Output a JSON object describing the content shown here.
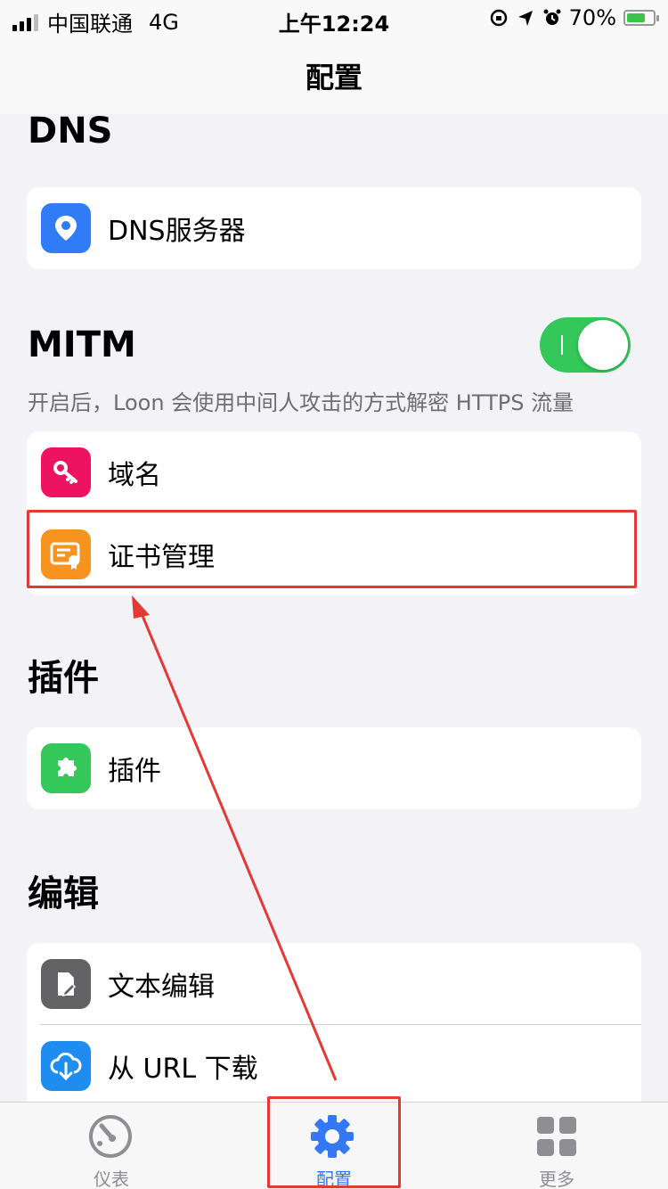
{
  "status_bar": {
    "carrier": "中国联通",
    "network": "4G",
    "time": "上午12:24",
    "battery": "70%",
    "battery_level": 0.7
  },
  "nav": {
    "title": "配置"
  },
  "sections": {
    "dns": {
      "title": "DNS",
      "items": [
        {
          "label": "DNS服务器",
          "icon": "location-pin-icon",
          "color": "#2f7cf6"
        }
      ]
    },
    "mitm": {
      "title": "MITM",
      "toggle_on": true,
      "note": "开启后，Loon 会使用中间人攻击的方式解密 HTTPS 流量",
      "items": [
        {
          "label": "域名",
          "icon": "key-icon",
          "color": "#ee1360"
        },
        {
          "label": "证书管理",
          "icon": "certificate-icon",
          "color": "#f7931e"
        }
      ]
    },
    "plugins": {
      "title": "插件",
      "items": [
        {
          "label": "插件",
          "icon": "puzzle-icon",
          "color": "#34c759"
        }
      ]
    },
    "edit": {
      "title": "编辑",
      "items": [
        {
          "label": "文本编辑",
          "icon": "document-edit-icon",
          "color": "#636366"
        },
        {
          "label": "从 URL 下载",
          "icon": "cloud-download-icon",
          "color": "#1f8cf0"
        }
      ]
    }
  },
  "tabbar": {
    "tabs": [
      {
        "label": "仪表",
        "icon": "gauge-icon",
        "active": false
      },
      {
        "label": "配置",
        "icon": "gear-icon",
        "active": true
      },
      {
        "label": "更多",
        "icon": "grid-icon",
        "active": false
      }
    ]
  },
  "colors": {
    "accent": "#3478f6",
    "highlight": "#e53935",
    "toggle_on": "#34c759"
  }
}
